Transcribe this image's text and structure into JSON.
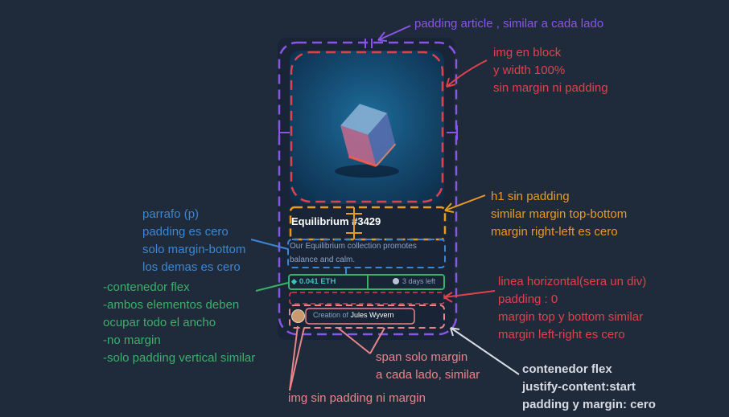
{
  "card": {
    "title": "Equilibrium #3429",
    "description": "Our Equilibrium collection promotes balance and calm.",
    "price": "0.041 ETH",
    "time_left": "3 days left",
    "creation_prefix": "Creation of",
    "creator": "Jules Wyvern"
  },
  "annotations": {
    "padding_article": "padding article , similar a cada lado",
    "img": [
      "img en block",
      "y width 100%",
      "sin margin ni padding"
    ],
    "h1": [
      "h1 sin padding",
      "similar margin top-bottom",
      "margin right-left es cero"
    ],
    "parrafo": [
      "parrafo (p)",
      "padding es cero",
      "solo margin-bottom",
      "los demas es cero"
    ],
    "flex_container": [
      "-contenedor flex",
      "-ambos elementos deben",
      "ocupar todo el ancho",
      "-no margin",
      "-solo padding vertical similar"
    ],
    "linea": [
      "linea horizontal(sera un div)",
      "padding : 0",
      "margin top y bottom similar",
      "margin left-right es cero"
    ],
    "span": [
      "span solo margin",
      "a cada lado, similar"
    ],
    "img_avatar": "img sin padding ni margin",
    "footer_flex": [
      "contenedor flex",
      "justify-content:start",
      "padding y margin: cero"
    ]
  },
  "colors": {
    "background": "#1f2a3a",
    "purple": "#8a55e6",
    "red": "#e0424d",
    "orange": "#e89a25",
    "blue": "#3c86d2",
    "green": "#3bb06b",
    "pink": "#e8858a",
    "white": "#d9dbe3"
  }
}
